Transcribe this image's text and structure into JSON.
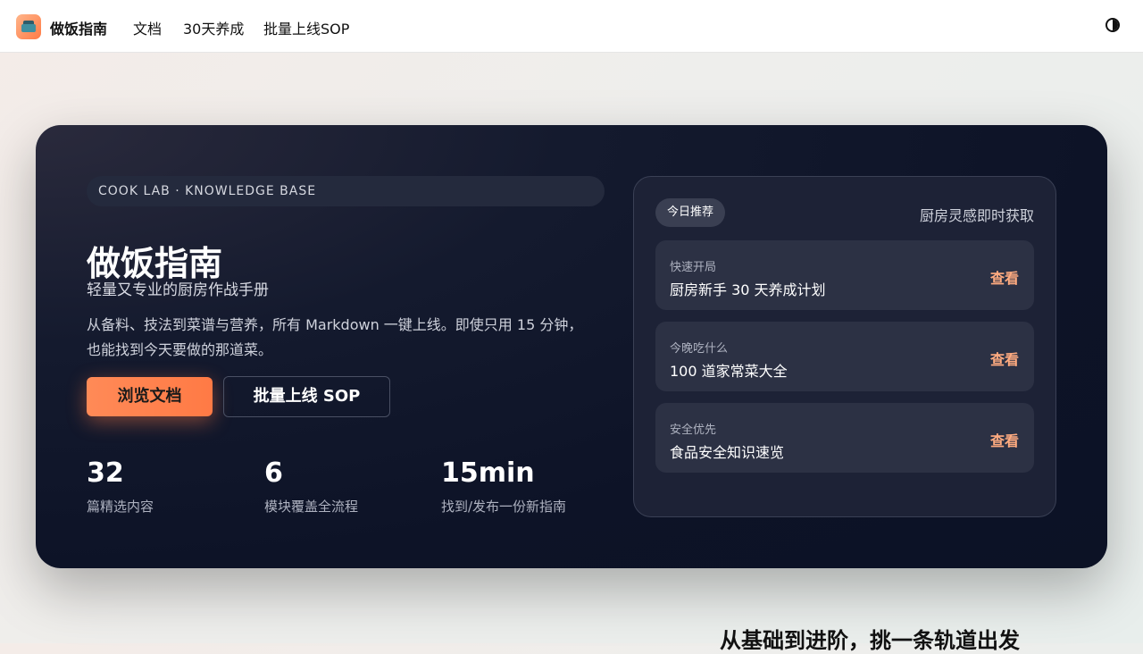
{
  "header": {
    "brand": "做饭指南",
    "nav": [
      "文档",
      "30天养成",
      "批量上线SOP"
    ],
    "logo_icon": "cooking-pot-icon",
    "theme_icon": "half-circle-contrast-icon"
  },
  "hero": {
    "tag": "COOK LAB · KNOWLEDGE BASE",
    "title": "做饭指南",
    "subtitle": "轻量又专业的厨房作战手册",
    "desc_line1": "从备料、技法到菜谱与营养，所有 Markdown 一键上线。即使只用 15 分钟，",
    "desc_line2": "也能找到今天要做的那道菜。",
    "primary_button": "浏览文档",
    "secondary_button": "批量上线 SOP",
    "stats": [
      {
        "value": "32",
        "label": "篇精选内容"
      },
      {
        "value": "6",
        "label": "模块覆盖全流程"
      },
      {
        "value": "15min",
        "label": "找到/发布一份新指南"
      }
    ]
  },
  "panel": {
    "badge": "今日推荐",
    "note": "厨房灵感即时获取",
    "cards": [
      {
        "kicker": "快速开局",
        "title": "厨房新手 30 天养成计划",
        "link": "查看"
      },
      {
        "kicker": "今晚吃什么",
        "title": "100 道家常菜大全",
        "link": "查看"
      },
      {
        "kicker": "安全优先",
        "title": "食品安全知识速览",
        "link": "查看"
      }
    ]
  },
  "section": {
    "heading": "从基础到进阶，挑一条轨道出发"
  },
  "colors": {
    "accent": "#ff7a45",
    "hero_bg": "#0d1327",
    "link": "#ffab80"
  }
}
